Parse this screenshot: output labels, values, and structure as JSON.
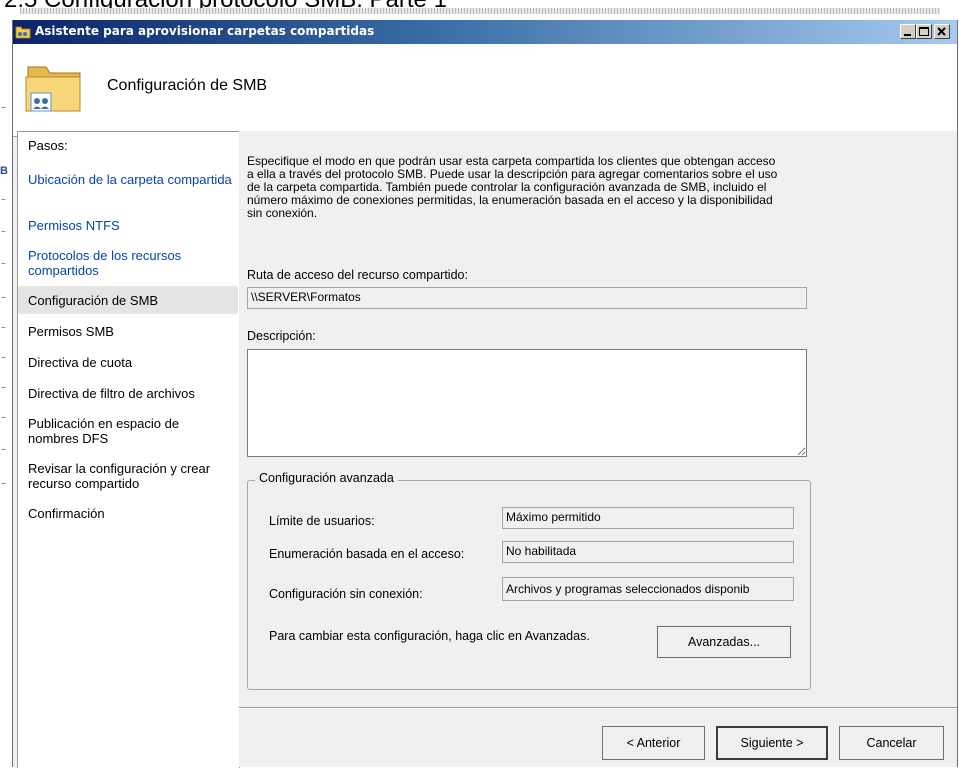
{
  "slide_title": "2.5 Configuración protocolo SMB. Parte 1",
  "background": {
    "ie_label": "B"
  },
  "window": {
    "title": "Asistente para aprovisionar carpetas compartidas",
    "header_title": "Configuración de SMB"
  },
  "sidebar": {
    "heading": "Pasos:",
    "items": [
      {
        "label": "Ubicación de la carpeta compartida",
        "state": "link"
      },
      {
        "label": "Permisos NTFS",
        "state": "link"
      },
      {
        "label": "Protocolos de los recursos compartidos",
        "state": "link"
      },
      {
        "label": "Configuración de SMB",
        "state": "current"
      },
      {
        "label": "Permisos SMB",
        "state": "pending"
      },
      {
        "label": "Directiva de cuota",
        "state": "pending"
      },
      {
        "label": "Directiva de filtro de archivos",
        "state": "pending"
      },
      {
        "label": "Publicación en espacio de nombres DFS",
        "state": "pending"
      },
      {
        "label": "Revisar la configuración y crear recurso compartido",
        "state": "pending"
      },
      {
        "label": "Confirmación",
        "state": "pending"
      }
    ]
  },
  "content": {
    "intro": "Especifique el modo en que podrán usar esta carpeta compartida los clientes que obtengan acceso a ella a través del protocolo SMB. Puede usar la descripción para agregar comentarios sobre el uso de la carpeta compartida. También puede controlar la configuración avanzada de SMB, incluido el número máximo de conexiones permitidas, la enumeración basada en el acceso y la disponibilidad sin conexión.",
    "path_label": "Ruta de acceso del recurso compartido:",
    "path_value": "\\\\SERVER\\Formatos",
    "description_label": "Descripción:",
    "description_value": "",
    "advanced": {
      "group_title": "Configuración avanzada",
      "user_limit_label": "Límite de usuarios:",
      "user_limit_value": "Máximo permitido",
      "abe_label": "Enumeración basada en el acceso:",
      "abe_value": "No habilitada",
      "offline_label": "Configuración sin conexión:",
      "offline_value": "Archivos y programas seleccionados disponib",
      "hint": "Para cambiar esta configuración, haga clic en Avanzadas.",
      "advanced_button": "Avanzadas..."
    }
  },
  "footer": {
    "back": "< Anterior",
    "next": "Siguiente >",
    "cancel": "Cancelar"
  },
  "colors": {
    "titlebar_start": "#0a246a",
    "titlebar_end": "#a6caf0",
    "link": "#0645ad",
    "selected_step": "#e4e4e4",
    "dialog_bg": "#f0f0f0"
  }
}
